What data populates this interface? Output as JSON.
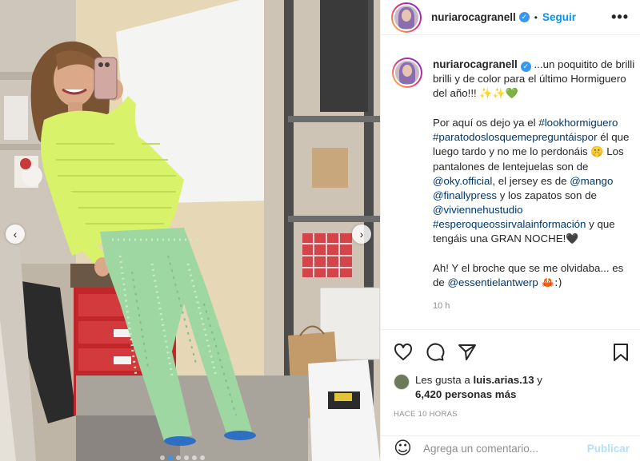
{
  "post": {
    "author": "nuriarocagranell",
    "follow_label": "Seguir",
    "separator": "•",
    "more_glyph": "•••",
    "verified_glyph": "✓"
  },
  "caption": {
    "line1": " ...un poquitito de brilli brilli y de color para el último Hormiguero del año!!! ",
    "line1_emoji": "✨✨💚",
    "p2_a": "Por aquí os dejo ya el ",
    "p2_tag1": "#lookhormiguero",
    "p2_b": " ",
    "p2_tag2": "#paratodoslosquemepreguntáispor",
    "p2_c": " él que luego tardo y no me lo perdonáis ",
    "p2_emoji1": "🤫",
    "p2_d": " Los pantalones de lentejuelas son de ",
    "p2_tag3": "@oky.official",
    "p2_e": ", el jersey es de ",
    "p2_tag4": "@mango",
    "p2_f": " ",
    "p2_tag5": "@finallypress",
    "p2_g": " y los zapatos son de ",
    "p2_tag6": "@viviennehustudio",
    "p2_h": " ",
    "p2_tag7": "#esperoqueossirvalainformación",
    "p2_i": " y que tengáis una GRAN NOCHE!",
    "p2_emoji2": "🖤",
    "p3_a": "Ah! Y el broche que se me olvidaba... es de ",
    "p3_tag": "@essentielantwerp",
    "p3_emoji": " 🦀:)",
    "time": "10 h"
  },
  "likes": {
    "prefix": "Les gusta a ",
    "user": "luis.arias.13",
    "middle": " y ",
    "others": "6,420 personas más"
  },
  "ago": "HACE 10 HORAS",
  "comment": {
    "placeholder": "Agrega un comentario...",
    "publish": "Publicar",
    "emoji_icon": "☺"
  },
  "carousel": {
    "prev_glyph": "‹",
    "next_glyph": "›",
    "dots": 6,
    "active_dot": 1
  },
  "colors": {
    "accent": "#0095f6",
    "verified": "#3897f0",
    "sweater": "#d8f26a",
    "pants": "#9fd7a3"
  }
}
